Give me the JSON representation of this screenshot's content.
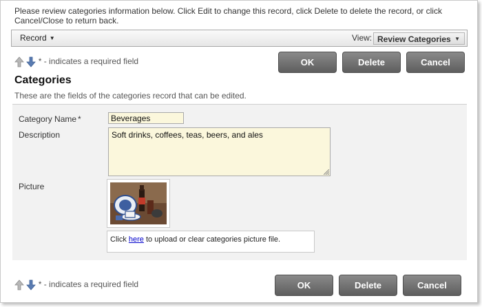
{
  "intro_text": "Please review categories information below. Click Edit to change this record, click Delete to delete the record, or click Cancel/Close to return back.",
  "toolbar": {
    "record_menu": "Record",
    "view_label": "View:",
    "view_selected": "Review Categories"
  },
  "required_note": "* - indicates a required field",
  "buttons": {
    "ok": "OK",
    "delete": "Delete",
    "cancel": "Cancel"
  },
  "section": {
    "title": "Categories",
    "description": "These are the fields of the categories record that can be edited."
  },
  "fields": {
    "category_name": {
      "label": "Category Name",
      "required_mark": "*",
      "value": "Beverages"
    },
    "description": {
      "label": "Description",
      "value": "Soft drinks, coffees, teas, beers, and ales"
    },
    "picture": {
      "label": "Picture",
      "upload_prefix": "Click ",
      "upload_link": "here",
      "upload_suffix": " to upload or clear categories picture file."
    }
  },
  "icons": {
    "up": "arrow-up-icon",
    "down": "arrow-down-icon",
    "caret": "caret-down-icon"
  }
}
